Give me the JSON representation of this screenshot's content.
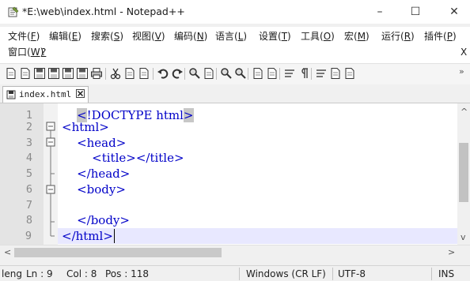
{
  "window": {
    "title": "*E:\\web\\index.html - Notepad++",
    "minimize_glyph": "–",
    "maximize_glyph": "☐",
    "close_glyph": "✕"
  },
  "menu": {
    "row1": [
      {
        "text": "文件(",
        "key": "F",
        "end": ")"
      },
      {
        "text": "编辑(",
        "key": "E",
        "end": ")"
      },
      {
        "text": "搜索(",
        "key": "S",
        "end": ")"
      },
      {
        "text": "视图(",
        "key": "V",
        "end": ")"
      },
      {
        "text": "编码(",
        "key": "N",
        "end": ")"
      },
      {
        "text": "语言(",
        "key": "L",
        "end": ")"
      },
      {
        "text": "设置(",
        "key": "T",
        "end": ")"
      },
      {
        "text": "工具(",
        "key": "O",
        "end": ")"
      },
      {
        "text": "宏(",
        "key": "M",
        "end": ")"
      },
      {
        "text": "运行(",
        "key": "R",
        "end": ")"
      },
      {
        "text": "插件(",
        "key": "P",
        "end": ")"
      }
    ],
    "row2": [
      {
        "text": "窗口(",
        "key": "W",
        "end": ")"
      },
      {
        "text": "",
        "key": "?",
        "end": ""
      }
    ],
    "close_doc": "X"
  },
  "toolbar": {
    "icons": [
      "new-file-icon",
      "open-file-icon",
      "save-icon",
      "save-all-icon",
      "close-icon",
      "close-all-icon",
      "print-icon",
      "cut-icon",
      "copy-icon",
      "paste-icon",
      "undo-icon",
      "redo-icon",
      "find-icon",
      "replace-icon",
      "zoom-in-icon",
      "zoom-out-icon",
      "sync-v-icon",
      "sync-h-icon",
      "word-wrap-icon",
      "show-all-chars-icon",
      "indent-guide-icon",
      "doc-map-icon",
      "function-list-icon"
    ],
    "overflow": "»"
  },
  "tab": {
    "label": "index.html"
  },
  "editor": {
    "lines": [
      {
        "num": "1",
        "indent": "    ",
        "text": "<!DOCTYPE html>"
      },
      {
        "num": "2",
        "indent": "",
        "text": "<html>"
      },
      {
        "num": "3",
        "indent": "    ",
        "text": "<head>"
      },
      {
        "num": "4",
        "indent": "        ",
        "text": "<title></title>"
      },
      {
        "num": "5",
        "indent": "    ",
        "text": "</head>"
      },
      {
        "num": "6",
        "indent": "    ",
        "text": "<body>"
      },
      {
        "num": "7",
        "indent": "",
        "text": ""
      },
      {
        "num": "8",
        "indent": "    ",
        "text": "</body>"
      },
      {
        "num": "9",
        "indent": "",
        "text": "</html>"
      }
    ]
  },
  "status": {
    "length": "leng",
    "ln": "Ln : 9",
    "col": "Col : 8",
    "pos": "Pos : 118",
    "eol": "Windows (CR LF)",
    "encoding": "UTF-8",
    "mode": "INS"
  },
  "colors": {
    "tag": "#0000c8",
    "doctype_highlight": "#c7c7c7",
    "gutter": "#e4e4e4"
  }
}
